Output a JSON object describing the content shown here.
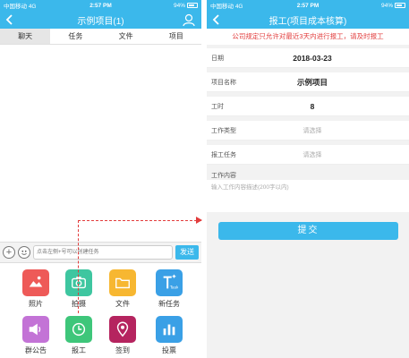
{
  "colors": {
    "primary": "#3bb8eb",
    "notice_red": "#e23c3c"
  },
  "status_bar": {
    "carrier": "中国移动",
    "network": "4G",
    "time": "2:57 PM",
    "battery": "94%"
  },
  "left_screen": {
    "title": "示例项目(1)",
    "tabs": [
      "聊天",
      "任务",
      "文件",
      "项目"
    ],
    "input": {
      "placeholder": "点击左侧+号可以创建任务",
      "send_label": "发送"
    },
    "apps": [
      {
        "label": "照片",
        "icon": "photo-icon",
        "color": "#ee5a58"
      },
      {
        "label": "拍摄",
        "icon": "camera-icon",
        "color": "#3ec6a0"
      },
      {
        "label": "文件",
        "icon": "folder-icon",
        "color": "#f7b731"
      },
      {
        "label": "新任务",
        "icon": "new-task-icon",
        "color": "#3aa0e6"
      },
      {
        "label": "群公告",
        "icon": "announcement-icon",
        "color": "#c373d6"
      },
      {
        "label": "报工",
        "icon": "clock-icon",
        "color": "#3ec67a"
      },
      {
        "label": "签到",
        "icon": "location-pin-icon",
        "color": "#b5245f"
      },
      {
        "label": "投票",
        "icon": "bar-chart-icon",
        "color": "#3aa0e6"
      }
    ]
  },
  "right_screen": {
    "title": "报工(项目成本核算)",
    "notice": "公司规定只允许对最近3天内进行报工，请及时报工",
    "fields": [
      {
        "label": "日期",
        "value": "2018-03-23",
        "placeholder": false
      },
      {
        "label": "项目名称",
        "value": "示例项目",
        "placeholder": false
      },
      {
        "label": "工时",
        "value": "8",
        "placeholder": false
      },
      {
        "label": "工作类型",
        "value": "请选择",
        "placeholder": true
      },
      {
        "label": "报工任务",
        "value": "请选择",
        "placeholder": true
      }
    ],
    "content_label": "工作内容",
    "content_placeholder": "输入工作内容描述(200字以内)",
    "submit_label": "提交"
  }
}
